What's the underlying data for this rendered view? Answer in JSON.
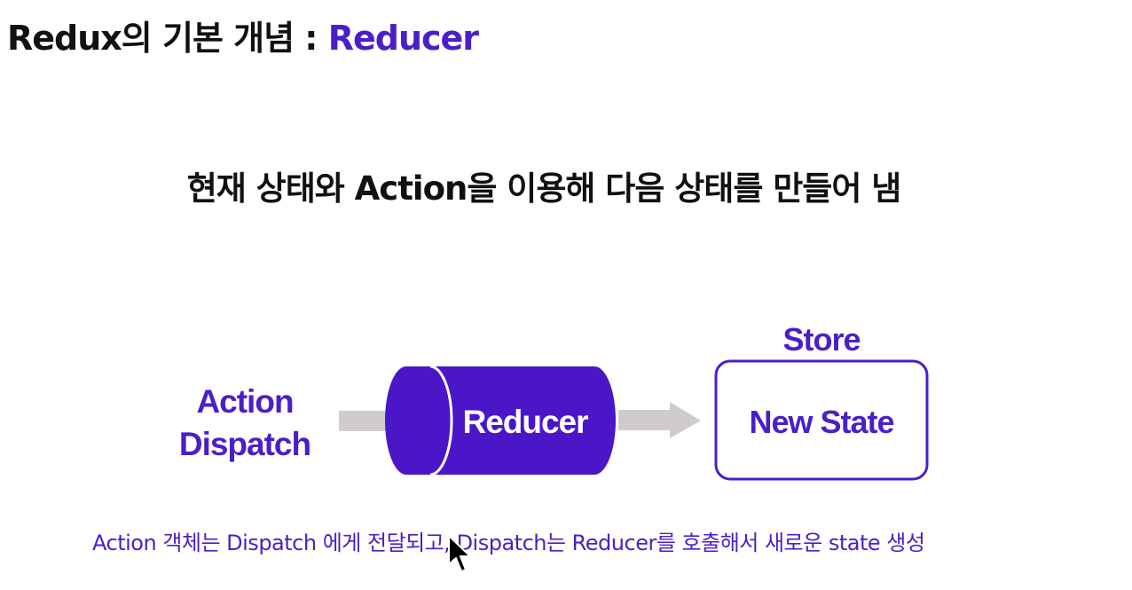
{
  "title": {
    "prefix": "Redux의 기본 개념 : ",
    "highlight": "Reducer"
  },
  "headline": "현재 상태와 Action을 이용해 다음 상태를 만들어 냄",
  "diagram": {
    "input_label_line1": "Action",
    "input_label_line2": "Dispatch",
    "reducer_label": "Reducer",
    "store_label": "Store",
    "output_label": "New State"
  },
  "caption": "Action 객체는 Dispatch 에게 전달되고, Dispatch는 Reducer를 호출해서 새로운 state 생성",
  "colors": {
    "accent": "#4a1fc8",
    "reducer_fill": "#4a16c8",
    "arrow": "#cfcbcf",
    "text": "#111111"
  },
  "icons": {
    "mouse_cursor": "cursor-arrow-icon"
  }
}
